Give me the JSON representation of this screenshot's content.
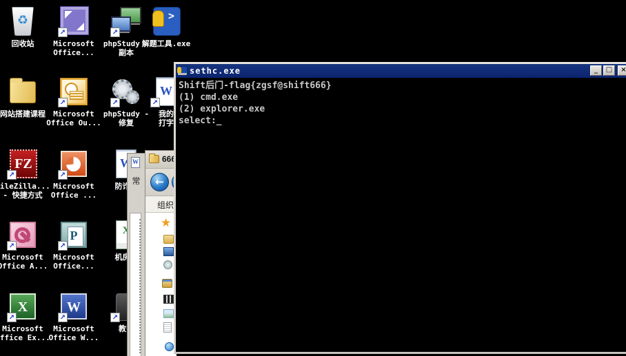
{
  "desktop": {
    "bg_color": "#000000",
    "icons": [
      {
        "name": "recycle-bin",
        "kind": "recycle",
        "col": 0,
        "row": 0,
        "arrow": false,
        "lines": [
          "回收站"
        ]
      },
      {
        "name": "ms-office-visio",
        "kind": "visio",
        "col": 1,
        "row": 0,
        "arrow": true,
        "lines": [
          "Microsoft",
          "Office..."
        ]
      },
      {
        "name": "phpstudy-copy",
        "kind": "phpstudy",
        "col": 2,
        "row": 0,
        "arrow": true,
        "lines": [
          "phpStudy -",
          "副本"
        ]
      },
      {
        "name": "jieti-tool-exe",
        "kind": "dosapp",
        "col": 3,
        "row": 0,
        "arrow": false,
        "lines": [
          "解题工具.exe"
        ]
      },
      {
        "name": "website-course",
        "kind": "folder",
        "col": 0,
        "row": 1,
        "arrow": false,
        "lines": [
          "网站搭建课程"
        ]
      },
      {
        "name": "ms-office-outlook",
        "kind": "outlook",
        "col": 1,
        "row": 1,
        "arrow": true,
        "lines": [
          "Microsoft",
          "Office Ou..."
        ]
      },
      {
        "name": "phpstudy-repair",
        "kind": "gears",
        "col": 2,
        "row": 1,
        "arrow": true,
        "lines": [
          "phpStudy -",
          "修复"
        ]
      },
      {
        "name": "my-typing",
        "kind": "worddoc",
        "col": 3,
        "row": 1,
        "arrow": true,
        "lines": [
          "我的",
          "打字"
        ]
      },
      {
        "name": "filezilla-shortcut",
        "kind": "filezilla",
        "col": 0,
        "row": 2,
        "arrow": true,
        "lines": [
          "FileZilla...",
          "- 快捷方式"
        ]
      },
      {
        "name": "ms-office-powerpoint",
        "kind": "powerpoint",
        "col": 1,
        "row": 2,
        "arrow": true,
        "lines": [
          "Microsoft",
          "Office ..."
        ]
      },
      {
        "name": "fangzhapian-doc",
        "kind": "worddoc",
        "col": 2,
        "row": 2,
        "arrow": false,
        "lines": [
          "防诈骗"
        ]
      },
      {
        "name": "ms-office-access",
        "kind": "access",
        "col": 0,
        "row": 3,
        "arrow": true,
        "lines": [
          "Microsoft",
          "Office A..."
        ]
      },
      {
        "name": "ms-office-publisher",
        "kind": "publisher",
        "col": 1,
        "row": 3,
        "arrow": true,
        "lines": [
          "Microsoft",
          "Office..."
        ]
      },
      {
        "name": "jifang-doc",
        "kind": "exceldoc",
        "col": 2,
        "row": 3,
        "arrow": false,
        "lines": [
          "机房采"
        ]
      },
      {
        "name": "ms-office-excel",
        "kind": "excel",
        "col": 0,
        "row": 4,
        "arrow": true,
        "lines": [
          "Microsoft",
          "Office Ex..."
        ]
      },
      {
        "name": "ms-office-word",
        "kind": "word",
        "col": 1,
        "row": 4,
        "arrow": true,
        "lines": [
          "Microsoft",
          "Office W..."
        ]
      },
      {
        "name": "jiaoshi-item",
        "kind": "dark",
        "col": 2,
        "row": 4,
        "arrow": true,
        "lines": [
          "教师"
        ]
      }
    ]
  },
  "word_strip": {
    "tab_label": "常"
  },
  "explorer": {
    "title": "666",
    "back_icon": "←",
    "organize_label": "组织",
    "sidebar_icons": [
      {
        "name": "favorites-star-icon",
        "kind": "sb-star",
        "glyph": "★"
      },
      {
        "name": "downloads-folder-icon",
        "kind": "sb-folder",
        "glyph": ""
      },
      {
        "name": "desktop-icon",
        "kind": "sb-desktop",
        "glyph": ""
      },
      {
        "name": "recent-places-icon",
        "kind": "sb-recent",
        "glyph": ""
      },
      {
        "name": "libraries-folder-icon",
        "kind": "sb-lib",
        "glyph": ""
      },
      {
        "name": "videos-icon",
        "kind": "sb-video",
        "glyph": ""
      },
      {
        "name": "pictures-icon",
        "kind": "sb-pic",
        "glyph": ""
      },
      {
        "name": "documents-icon",
        "kind": "sb-doc",
        "glyph": ""
      },
      {
        "name": "network-sphere-icon",
        "kind": "sb-sphere",
        "glyph": ""
      }
    ]
  },
  "console": {
    "title": "sethc.exe",
    "title_bar_color": "#0c2470",
    "text_color": "#c8c8c8",
    "buttons": {
      "minimize": "_",
      "maximize": "□",
      "close": "×"
    },
    "lines": [
      "Shift后门-flag{zgsf@shift666}",
      "(1) cmd.exe",
      "(2) explorer.exe",
      "select:"
    ],
    "cursor": "_"
  }
}
